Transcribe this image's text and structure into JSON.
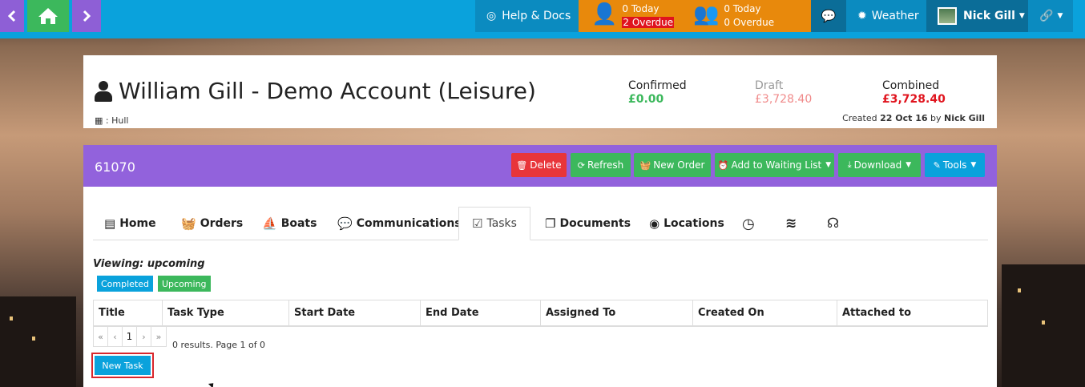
{
  "topbar": {
    "help_label": "Help & Docs",
    "my_tasks": {
      "today": "0 Today",
      "overdue": "2 Overdue"
    },
    "team_tasks": {
      "today": "0 Today",
      "overdue": "0 Overdue"
    },
    "weather_label": "Weather",
    "user_name": "Nick Gill"
  },
  "account": {
    "title": "William Gill - Demo Account (Leisure)",
    "location": ": Hull",
    "confirmed_label": "Confirmed",
    "confirmed_value": "£0.00",
    "draft_label": "Draft",
    "draft_value": "£3,728.40",
    "combined_label": "Combined",
    "combined_value": "£3,728.40",
    "created_prefix": "Created",
    "created_date": "22 Oct 16",
    "created_by_word": "by",
    "created_by": "Nick Gill"
  },
  "panel": {
    "id": "61070",
    "actions": {
      "delete": "Delete",
      "refresh": "Refresh",
      "new_order": "New Order",
      "waiting_list": "Add to Waiting List",
      "download": "Download",
      "tools": "Tools"
    }
  },
  "tabs": {
    "home": "Home",
    "orders": "Orders",
    "boats": "Boats",
    "communications": "Communications",
    "tasks": "Tasks",
    "documents": "Documents",
    "locations": "Locations"
  },
  "tasks": {
    "viewing": "Viewing: upcoming",
    "filter_completed": "Completed",
    "filter_upcoming": "Upcoming",
    "columns": [
      "Title",
      "Task Type",
      "Start Date",
      "End Date",
      "Assigned To",
      "Created On",
      "Attached to"
    ],
    "pager": {
      "first": "«",
      "prev": "‹",
      "page": "1",
      "next": "›",
      "last": "»"
    },
    "results_text": "0 results. Page 1 of 0",
    "new_task_label": "New Task"
  },
  "colors": {
    "topbar": "#0aa2dc",
    "purple": "#9262dc",
    "green": "#3cb85c",
    "orange": "#e8890c",
    "red": "#e8353a"
  }
}
